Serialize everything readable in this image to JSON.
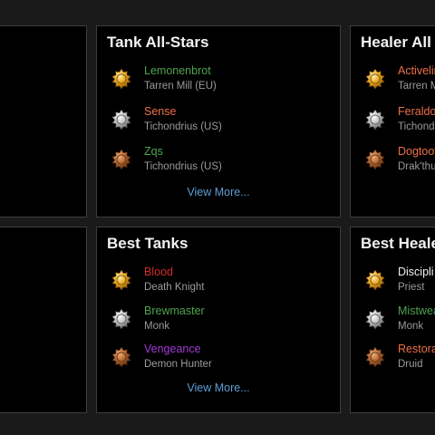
{
  "colors": {
    "background": "#1a1a1a",
    "panel": "#000000",
    "border": "#3d3d3d",
    "link": "#5e9ed6",
    "gold": "#e6a31c",
    "silver": "#bfbfbf",
    "bronze": "#b0642e"
  },
  "panels": {
    "tank_allstars": {
      "title": "Tank All-Stars",
      "view_more": "View More...",
      "entries": [
        {
          "name": "Lemonenbrot",
          "sub": "Tarren Mill (EU)",
          "name_color": "#4fa34f",
          "medal": "gold-medal-icon"
        },
        {
          "name": "Sense",
          "sub": "Tichondrius (US)",
          "name_color": "#ee6f4a",
          "medal": "silver-medal-icon"
        },
        {
          "name": "Zqs",
          "sub": "Tichondrius (US)",
          "name_color": "#4fa34f",
          "medal": "bronze-medal-icon"
        }
      ]
    },
    "healer_allstars": {
      "title": "Healer All",
      "entries": [
        {
          "name": "Activelin",
          "sub": "Tarren M",
          "name_color": "#ee6f4a",
          "medal": "gold-medal-icon"
        },
        {
          "name": "Feraldo",
          "sub": "Tichond",
          "name_color": "#ee6f4a",
          "medal": "silver-medal-icon"
        },
        {
          "name": "Dogtoot",
          "sub": "Drak'thu",
          "name_color": "#ee6f4a",
          "medal": "bronze-medal-icon"
        }
      ]
    },
    "best_tanks": {
      "title": "Best Tanks",
      "view_more": "View More...",
      "entries": [
        {
          "name": "Blood",
          "sub": "Death Knight",
          "name_color": "#d42a2a",
          "medal": "gold-medal-icon"
        },
        {
          "name": "Brewmaster",
          "sub": "Monk",
          "name_color": "#4fa34f",
          "medal": "silver-medal-icon"
        },
        {
          "name": "Vengeance",
          "sub": "Demon Hunter",
          "name_color": "#a23bd6",
          "medal": "bronze-medal-icon"
        }
      ]
    },
    "best_healers": {
      "title": "Best Heale",
      "entries": [
        {
          "name": "Discipli",
          "sub": "Priest",
          "name_color": "#f2f2f2",
          "medal": "gold-medal-icon"
        },
        {
          "name": "Mistwea",
          "sub": "Monk",
          "name_color": "#4fa34f",
          "medal": "silver-medal-icon"
        },
        {
          "name": "Restora",
          "sub": "Druid",
          "name_color": "#ee6f4a",
          "medal": "bronze-medal-icon"
        }
      ]
    }
  }
}
